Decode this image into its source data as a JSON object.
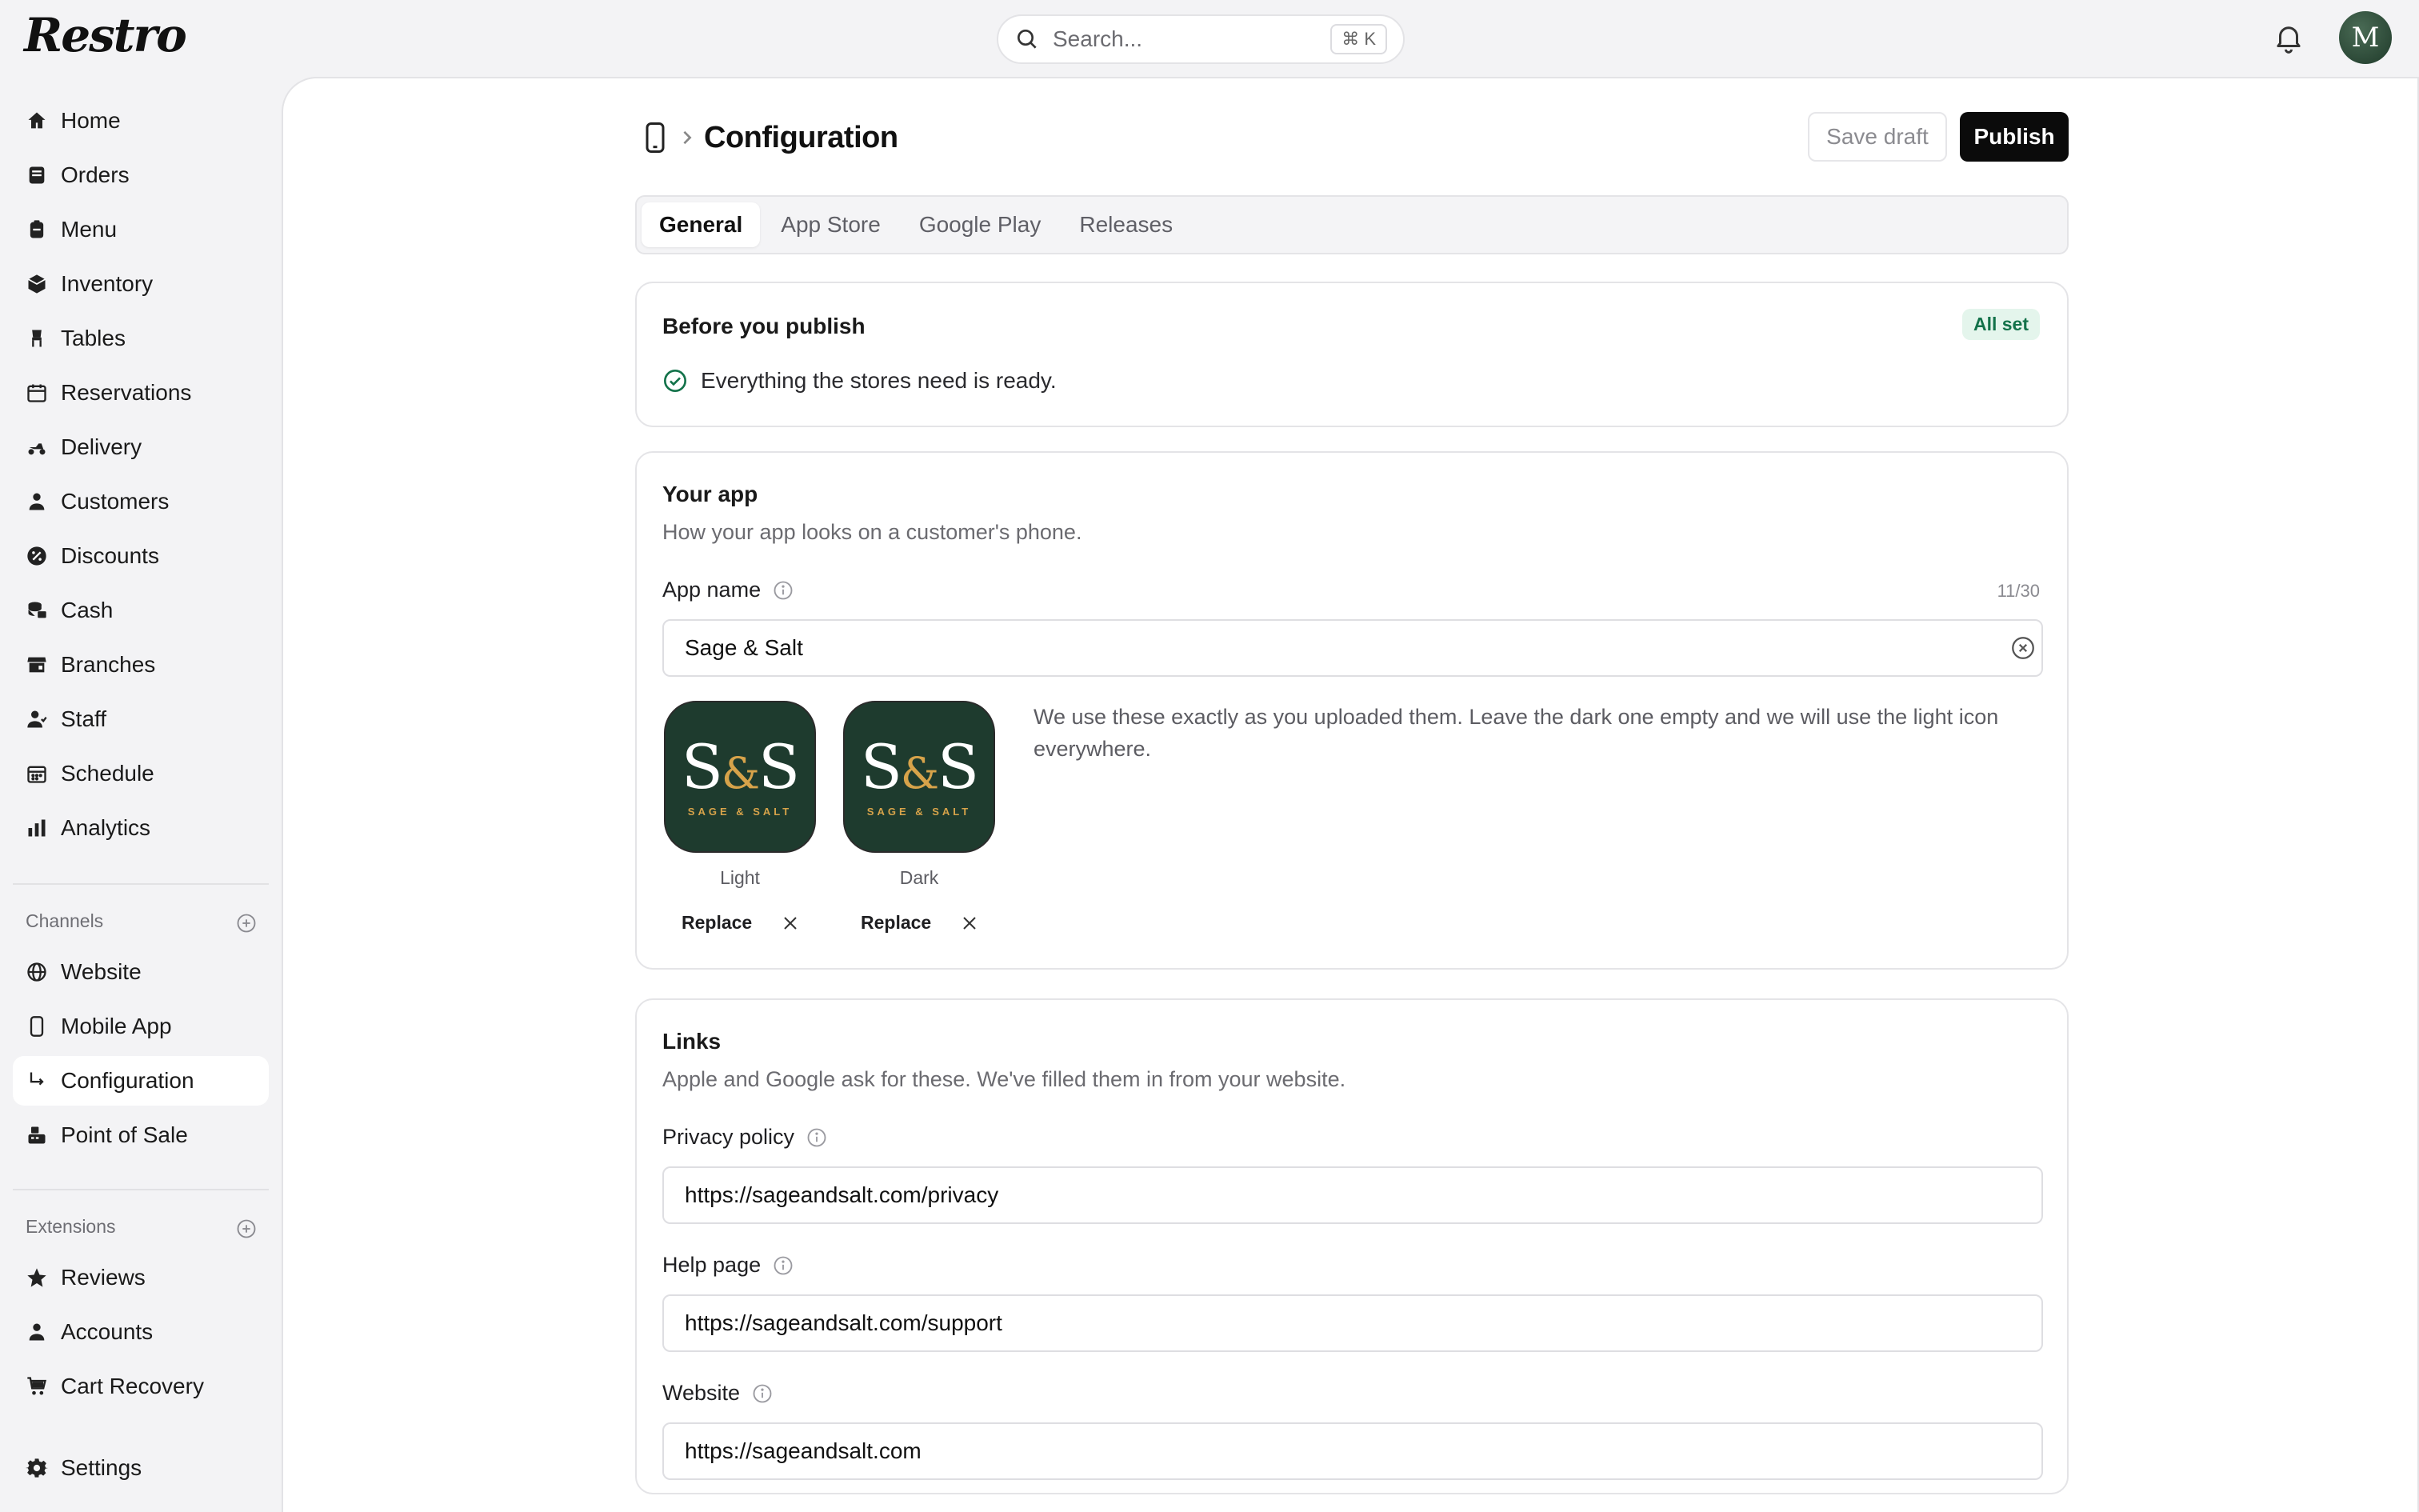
{
  "app": {
    "logo": "Restro"
  },
  "search": {
    "placeholder": "Search...",
    "shortcut": "⌘ K"
  },
  "user": {
    "avatar_initial": "M"
  },
  "sidebar": {
    "main_items": [
      {
        "label": "Home",
        "icon": "home-icon"
      },
      {
        "label": "Orders",
        "icon": "orders-icon"
      },
      {
        "label": "Menu",
        "icon": "menu-icon"
      },
      {
        "label": "Inventory",
        "icon": "inventory-icon"
      },
      {
        "label": "Tables",
        "icon": "tables-icon"
      },
      {
        "label": "Reservations",
        "icon": "calendar-icon"
      },
      {
        "label": "Delivery",
        "icon": "scooter-icon"
      },
      {
        "label": "Customers",
        "icon": "person-icon"
      },
      {
        "label": "Discounts",
        "icon": "percent-icon"
      },
      {
        "label": "Cash",
        "icon": "cash-icon"
      },
      {
        "label": "Branches",
        "icon": "store-icon"
      },
      {
        "label": "Staff",
        "icon": "staff-icon"
      },
      {
        "label": "Schedule",
        "icon": "schedule-icon"
      },
      {
        "label": "Analytics",
        "icon": "chart-icon"
      }
    ],
    "channels_title": "Channels",
    "channels": [
      {
        "label": "Website",
        "icon": "globe-icon"
      },
      {
        "label": "Mobile App",
        "icon": "phone-icon"
      },
      {
        "label": "Configuration",
        "icon": "sub-arrow-icon",
        "active": true
      },
      {
        "label": "Point of Sale",
        "icon": "register-icon"
      }
    ],
    "extensions_title": "Extensions",
    "extensions": [
      {
        "label": "Reviews",
        "icon": "star-icon"
      },
      {
        "label": "Accounts",
        "icon": "person-icon"
      },
      {
        "label": "Cart Recovery",
        "icon": "cart-icon"
      }
    ],
    "settings": {
      "label": "Settings",
      "icon": "gear-icon"
    }
  },
  "header": {
    "title": "Configuration",
    "save_draft": "Save draft",
    "publish": "Publish"
  },
  "tabs": [
    "General",
    "App Store",
    "Google Play",
    "Releases"
  ],
  "active_tab": "General",
  "publish_card": {
    "title": "Before you publish",
    "badge": "All set",
    "status": "Everything the stores need is ready."
  },
  "app_card": {
    "title": "Your app",
    "subtitle": "How your app looks on a customer's phone.",
    "name_label": "App name",
    "name_value": "Sage & Salt",
    "name_counter": "11/30",
    "icon_text_left": "S",
    "icon_text_amp": "&",
    "icon_text_right": "S",
    "icon_subtext": "SAGE & SALT",
    "light_label": "Light",
    "dark_label": "Dark",
    "replace_label": "Replace",
    "description": "We use these exactly as you uploaded them. Leave the dark one empty and we will use the light icon everywhere."
  },
  "links_card": {
    "title": "Links",
    "subtitle": "Apple and Google ask for these. We've filled them in from your website.",
    "privacy_label": "Privacy policy",
    "privacy_value": "https://sageandsalt.com/privacy",
    "help_label": "Help page",
    "help_value": "https://sageandsalt.com/support",
    "website_label": "Website",
    "website_value": "https://sageandsalt.com"
  },
  "colors": {
    "accent_dark": "#0b0b0b",
    "badge_green": "#13724a",
    "icon_green": "#1e3b2e",
    "icon_gold": "#d7a34a"
  }
}
